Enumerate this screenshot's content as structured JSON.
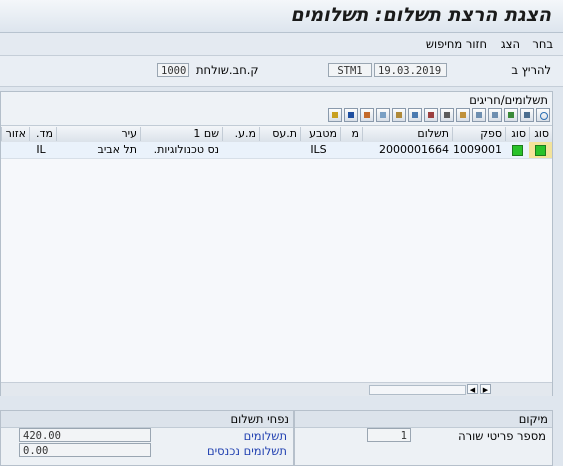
{
  "window": {
    "title": "הצגת הרצת תשלום: תשלומים"
  },
  "menu": {
    "items": [
      "בחר",
      "הצג",
      "חזור מחיפוש"
    ]
  },
  "selection": {
    "run_date_label": "להריץ ב",
    "run_date_value": "19.03.2019",
    "run_id_value": "STM1",
    "company_code_label": "ק.חב.שולחת",
    "company_code_value": "1000"
  },
  "grid": {
    "title": "תשלומים/חריגים",
    "columns": [
      "סוג",
      "סוג",
      "ספק",
      "תשלום",
      "מ",
      "מטבע",
      "ת.עס",
      "מ.ע.",
      "שם 1",
      "עיר",
      "מד.",
      "אזור"
    ],
    "rows": [
      {
        "vendor": "1009001",
        "payment": "2000001664",
        "currency": "ILS",
        "name1": "נס טכנולוגיות.",
        "city": "תל אביב",
        "country": "IL"
      }
    ],
    "status_color": "#29c229"
  },
  "toolbar": {
    "icons": [
      "find-icon",
      "print-icon",
      "filter-icon",
      "sort-ascending-icon",
      "sort-descending-icon",
      "find-next-icon",
      "total-icon",
      "subtotal-icon",
      "export-icon",
      "graphic-icon",
      "layout-icon",
      "select-layout-icon",
      "information-icon",
      "chart-icon"
    ]
  },
  "location": {
    "title": "מיקום",
    "line_items_label": "מספר פריטי שורה",
    "line_items_value": "1"
  },
  "payment_volume": {
    "title": "נפחי תשלום",
    "payments_label": "תשלומים",
    "payments_value": "420.00",
    "incoming_label": "תשלומים נכנסים",
    "incoming_value": "0.00"
  }
}
